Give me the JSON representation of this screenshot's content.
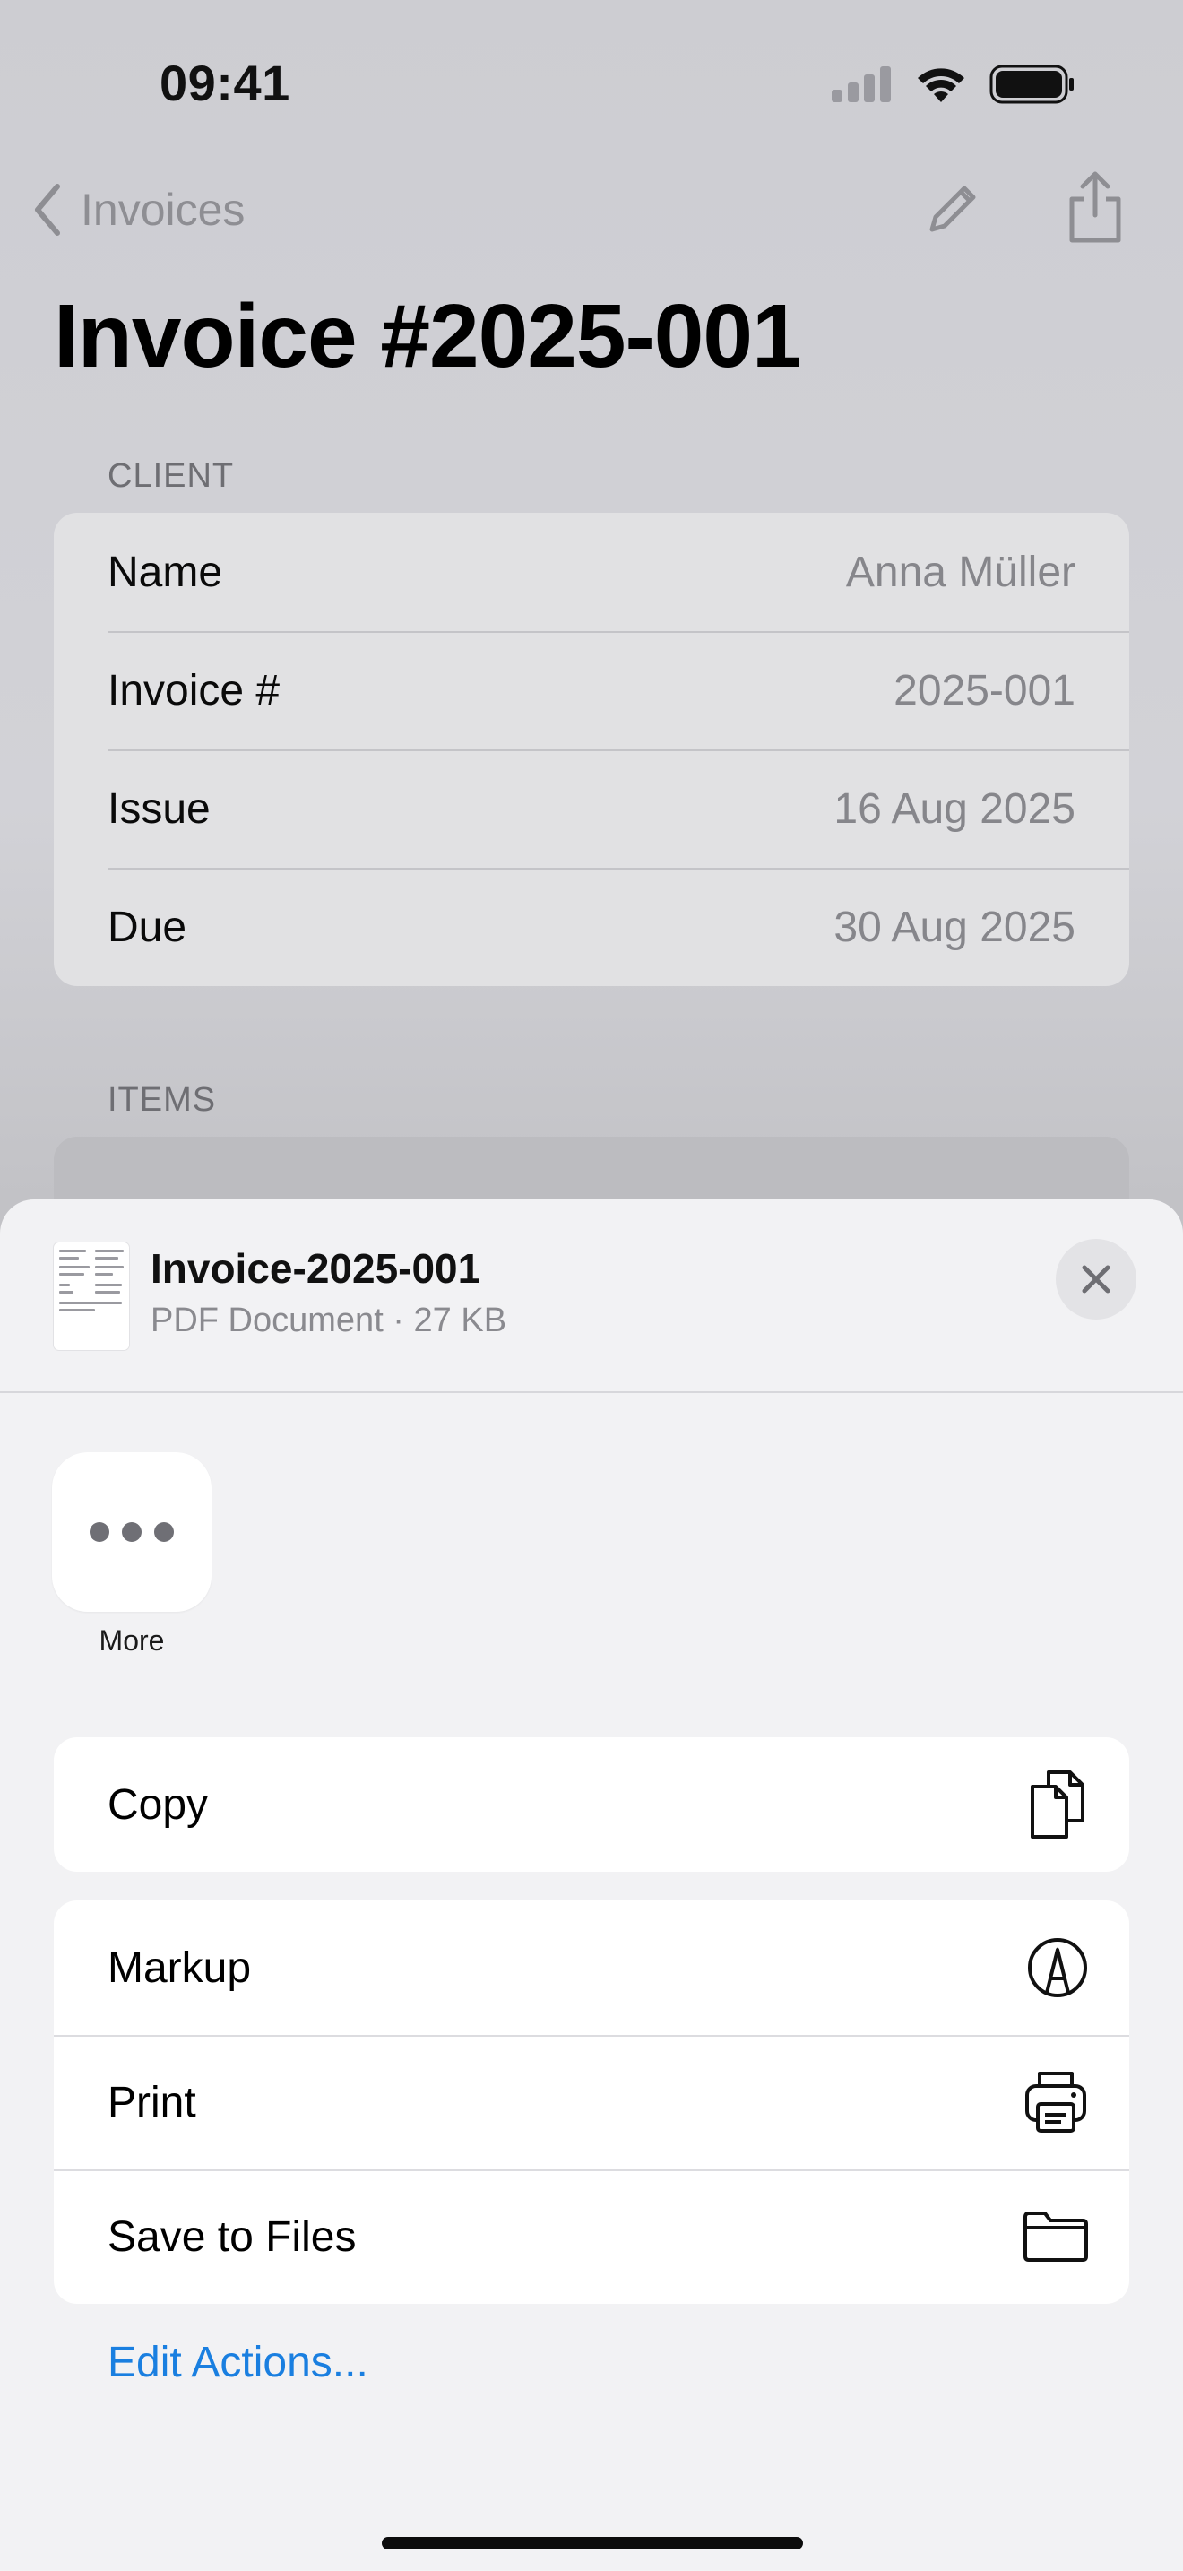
{
  "status_bar": {
    "time": "09:41"
  },
  "nav": {
    "back_label": "Invoices"
  },
  "page": {
    "title": "Invoice #2025-001"
  },
  "client": {
    "label": "CLIENT",
    "rows": [
      {
        "key": "Name",
        "value": "Anna Müller"
      },
      {
        "key": "Invoice #",
        "value": "2025-001"
      },
      {
        "key": "Issue",
        "value": "16 Aug 2025"
      },
      {
        "key": "Due",
        "value": "30 Aug 2025"
      }
    ]
  },
  "items": {
    "label": "ITEMS"
  },
  "share_sheet": {
    "document_name": "Invoice-2025-001",
    "document_meta": "PDF Document · 27 KB",
    "apps": [
      {
        "label": "More",
        "icon": "ellipsis-icon"
      }
    ],
    "actions": [
      {
        "label": "Copy",
        "icon": "copy-icon"
      },
      {
        "label": "Markup",
        "icon": "markup-icon"
      },
      {
        "label": "Print",
        "icon": "print-icon"
      },
      {
        "label": "Save to Files",
        "icon": "folder-icon"
      }
    ],
    "edit_actions_label": "Edit Actions..."
  },
  "colors": {
    "accent": "#1a7fe0",
    "sheet_background": "#f2f2f4",
    "dim_background": "#cfcfd4"
  }
}
